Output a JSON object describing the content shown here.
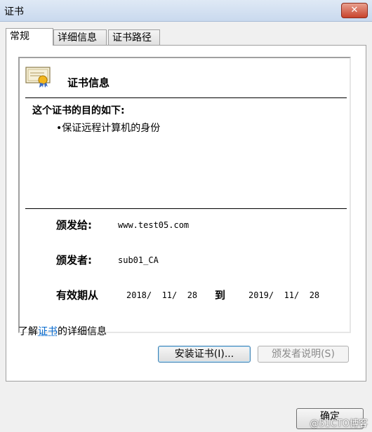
{
  "window": {
    "title": "证书",
    "close_glyph": "✕"
  },
  "tabs": [
    {
      "label": "常规"
    },
    {
      "label": "详细信息"
    },
    {
      "label": "证书路径"
    }
  ],
  "cert": {
    "heading": "证书信息",
    "purpose_title": "这个证书的目的如下:",
    "purposes": [
      "•保证远程计算机的身份"
    ],
    "issued_to_label": "颁发给:",
    "issued_to_value": "www.test05.com",
    "issued_by_label": "颁发者:",
    "issued_by_value": "sub01_CA",
    "valid_from_label": "有效期从",
    "valid_from": "2018/  11/  28",
    "to_label": "到",
    "valid_to": "2019/  11/  28"
  },
  "buttons": {
    "install": "安装证书(I)...",
    "issuer_statement": "颁发者说明(S)",
    "ok": "确定"
  },
  "learn_more": {
    "prefix": "了解",
    "link": "证书",
    "suffix": "的详细信息"
  },
  "watermark": "@51CTO博客",
  "colors": {
    "link": "#0066cc",
    "close": "#c8432c"
  },
  "icons": {
    "close": "close-icon",
    "certificate": "certificate-icon"
  }
}
